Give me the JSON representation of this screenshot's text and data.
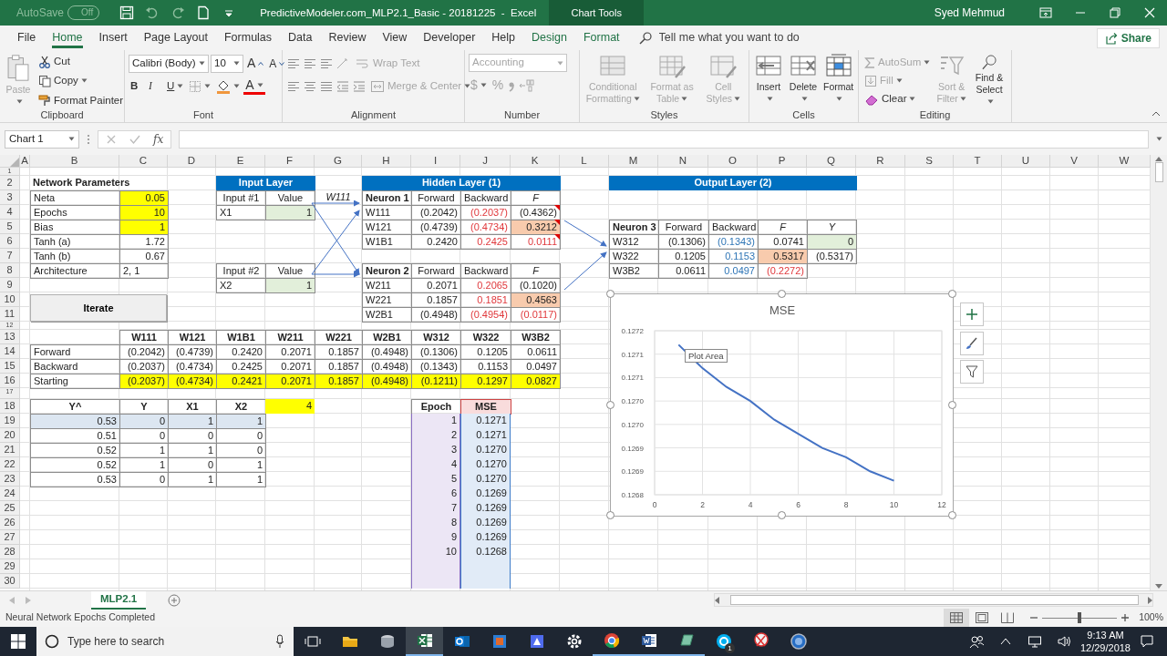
{
  "title_bar": {
    "autosave": {
      "label": "AutoSave",
      "toggle": "Off",
      "on": false
    },
    "title": "PredictiveModeler.com_MLP2.1_Basic - 20181225  -  Excel",
    "context": "Chart Tools",
    "user": "Syed Mehmud"
  },
  "tabs": [
    {
      "label": "File",
      "selected": false,
      "contextual": false
    },
    {
      "label": "Home",
      "selected": true,
      "contextual": false
    },
    {
      "label": "Insert",
      "selected": false,
      "contextual": false
    },
    {
      "label": "Page Layout",
      "selected": false,
      "contextual": false
    },
    {
      "label": "Formulas",
      "selected": false,
      "contextual": false
    },
    {
      "label": "Data",
      "selected": false,
      "contextual": false
    },
    {
      "label": "Review",
      "selected": false,
      "contextual": false
    },
    {
      "label": "View",
      "selected": false,
      "contextual": false
    },
    {
      "label": "Developer",
      "selected": false,
      "contextual": false
    },
    {
      "label": "Help",
      "selected": false,
      "contextual": false
    },
    {
      "label": "Design",
      "selected": false,
      "contextual": true
    },
    {
      "label": "Format",
      "selected": false,
      "contextual": true
    }
  ],
  "tell_me": {
    "placeholder": "Tell me what you want to do"
  },
  "share": "Share",
  "ribbon": {
    "clipboard": {
      "label": "Clipboard",
      "paste": {
        "label": "Paste",
        "disabled": true
      },
      "cut": "Cut",
      "copy": "Copy",
      "format_painter": "Format Painter"
    },
    "font": {
      "label": "Font",
      "name": "Calibri (Body)",
      "size": "10",
      "grow": "A",
      "shrink": "A",
      "bold": "B",
      "italic": "I",
      "underline": "U",
      "font_color": "A"
    },
    "alignment": {
      "label": "Alignment",
      "wrap_text": {
        "label": "Wrap Text",
        "disabled": true
      },
      "merge": {
        "label": "Merge & Center",
        "disabled": true
      }
    },
    "number": {
      "label": "Number",
      "format": {
        "value": "Accounting",
        "disabled": true
      },
      "currency": "$",
      "percent": "%"
    },
    "styles": {
      "label": "Styles",
      "items": [
        {
          "label": "Conditional Formatting",
          "disabled": true,
          "kind": "conditional"
        },
        {
          "label": "Format as Table",
          "disabled": true,
          "kind": "table"
        },
        {
          "label": "Cell Styles",
          "disabled": true,
          "kind": "styles"
        }
      ]
    },
    "cells": {
      "label": "Cells",
      "items": [
        {
          "label": "Insert",
          "disabled": false,
          "kind": "insert"
        },
        {
          "label": "Delete",
          "disabled": false,
          "kind": "delete"
        },
        {
          "label": "Format",
          "disabled": false,
          "kind": "format"
        }
      ]
    },
    "editing": {
      "label": "Editing",
      "autosum": {
        "label": "AutoSum",
        "disabled": true
      },
      "fill": {
        "label": "Fill",
        "disabled": true
      },
      "clear": {
        "label": "Clear",
        "disabled": false
      },
      "sort": {
        "label": "Sort & Filter",
        "disabled": true
      },
      "find": {
        "label": "Find & Select",
        "disabled": false
      }
    }
  },
  "formula_bar": {
    "name_box": "Chart 1",
    "function_label": "fx"
  },
  "sheet": {
    "columns": [
      "A",
      "B",
      "C",
      "D",
      "E",
      "F",
      "G",
      "H",
      "I",
      "J",
      "K",
      "L",
      "M",
      "N",
      "O",
      "P",
      "Q",
      "R",
      "S",
      "T",
      "U",
      "V",
      "W"
    ],
    "rows": [
      {
        "number": "1"
      },
      {
        "number": "2",
        "cells": {
          "B": {
            "text": "Network Parameters",
            "kind": "title"
          },
          "E": {
            "text": "Input Layer",
            "kind": "band"
          },
          "F": {
            "kind": "band"
          },
          "H": {
            "text": "Hidden Layer (1)",
            "kind": "band"
          },
          "I": {
            "kind": "band"
          },
          "J": {
            "kind": "band"
          },
          "K": {
            "kind": "band"
          },
          "M": {
            "text": "Output Layer (2)",
            "kind": "band"
          },
          "N": {
            "kind": "band"
          },
          "O": {
            "kind": "band"
          },
          "P": {
            "kind": "band"
          },
          "Q": {
            "kind": "band"
          }
        }
      },
      {
        "number": "3",
        "cells": {
          "B": {
            "text": "Neta",
            "kind": "label",
            "boxed": true
          },
          "C": {
            "text": "0.05",
            "kind": "param",
            "boxed": true
          },
          "E": {
            "text": "Input #1",
            "kind": "head",
            "boxed": true
          },
          "F": {
            "text": "Value",
            "kind": "head",
            "boxed": true
          },
          "G": {
            "text": "W111",
            "kind": "head-italic"
          },
          "H": {
            "text": "Neuron 1",
            "kind": "title",
            "boxed": true
          },
          "I": {
            "text": "Forward",
            "kind": "head",
            "boxed": true
          },
          "J": {
            "text": "Backward",
            "kind": "head",
            "boxed": true
          },
          "K": {
            "text": "F",
            "kind": "head-italic",
            "boxed": true
          }
        }
      },
      {
        "number": "4",
        "cells": {
          "B": {
            "text": "Epochs",
            "kind": "label",
            "boxed": true
          },
          "C": {
            "text": "10",
            "kind": "param",
            "boxed": true
          },
          "E": {
            "text": "X1",
            "kind": "label",
            "boxed": true
          },
          "F": {
            "text": "1",
            "kind": "given",
            "boxed": true
          },
          "H": {
            "text": "W111",
            "kind": "label",
            "boxed": true
          },
          "I": {
            "text": "(0.2042)",
            "kind": "num",
            "boxed": true
          },
          "J": {
            "text": "(0.2037)",
            "kind": "num-red",
            "boxed": true
          },
          "K": {
            "text": "(0.4362)",
            "kind": "num",
            "boxed": true,
            "comment": true
          }
        }
      },
      {
        "number": "5",
        "cells": {
          "B": {
            "text": "Bias",
            "kind": "label",
            "boxed": true
          },
          "C": {
            "text": "1",
            "kind": "param",
            "boxed": true
          },
          "H": {
            "text": "W121",
            "kind": "label",
            "boxed": true
          },
          "I": {
            "text": "(0.4739)",
            "kind": "num",
            "boxed": true
          },
          "J": {
            "text": "(0.4734)",
            "kind": "num-red",
            "boxed": true
          },
          "K": {
            "text": "0.3212",
            "kind": "peach",
            "boxed": true,
            "comment": true
          },
          "M": {
            "text": "Neuron 3",
            "kind": "title",
            "boxed": true
          },
          "N": {
            "text": "Forward",
            "kind": "head",
            "boxed": true
          },
          "O": {
            "text": "Backward",
            "kind": "head",
            "boxed": true
          },
          "P": {
            "text": "F",
            "kind": "head-italic",
            "boxed": true
          },
          "Q": {
            "text": "Y",
            "kind": "head-italic",
            "boxed": true
          }
        }
      },
      {
        "number": "6",
        "cells": {
          "B": {
            "text": "Tanh (a)",
            "kind": "label",
            "boxed": true
          },
          "C": {
            "text": "1.72",
            "kind": "num",
            "boxed": true
          },
          "H": {
            "text": "W1B1",
            "kind": "label",
            "boxed": true
          },
          "I": {
            "text": "0.2420",
            "kind": "num",
            "boxed": true
          },
          "J": {
            "text": "0.2425",
            "kind": "num-red",
            "boxed": true
          },
          "K": {
            "text": "0.0111",
            "kind": "num-red",
            "boxed": true,
            "comment": true
          },
          "M": {
            "text": "W312",
            "kind": "label",
            "boxed": true
          },
          "N": {
            "text": "(0.1306)",
            "kind": "num",
            "boxed": true
          },
          "O": {
            "text": "(0.1343)",
            "kind": "num-blue",
            "boxed": true
          },
          "P": {
            "text": "0.0741",
            "kind": "num",
            "boxed": true
          },
          "Q": {
            "text": "0",
            "kind": "given",
            "boxed": true
          }
        }
      },
      {
        "number": "7",
        "cells": {
          "B": {
            "text": "Tanh (b)",
            "kind": "label",
            "boxed": true
          },
          "C": {
            "text": "0.67",
            "kind": "num",
            "boxed": true
          },
          "M": {
            "text": "W322",
            "kind": "label",
            "boxed": true
          },
          "N": {
            "text": "0.1205",
            "kind": "num",
            "boxed": true
          },
          "O": {
            "text": "0.1153",
            "kind": "num-blue",
            "boxed": true
          },
          "P": {
            "text": "0.5317",
            "kind": "peach",
            "boxed": true
          },
          "Q": {
            "text": "(0.5317)",
            "kind": "num",
            "boxed": true
          }
        }
      },
      {
        "number": "8",
        "cells": {
          "B": {
            "text": "Architecture",
            "kind": "label",
            "boxed": true
          },
          "C": {
            "text": "2, 1",
            "kind": "label",
            "boxed": true
          },
          "E": {
            "text": "Input #2",
            "kind": "head",
            "boxed": true
          },
          "F": {
            "text": "Value",
            "kind": "head",
            "boxed": true
          },
          "H": {
            "text": "Neuron 2",
            "kind": "title",
            "boxed": true
          },
          "I": {
            "text": "Forward",
            "kind": "head",
            "boxed": true
          },
          "J": {
            "text": "Backward",
            "kind": "head",
            "boxed": true
          },
          "K": {
            "text": "F",
            "kind": "head-italic",
            "boxed": true
          },
          "M": {
            "text": "W3B2",
            "kind": "label",
            "boxed": true
          },
          "N": {
            "text": "0.0611",
            "kind": "num",
            "boxed": true
          },
          "O": {
            "text": "0.0497",
            "kind": "num-blue",
            "boxed": true
          },
          "P": {
            "text": "(0.2272)",
            "kind": "num-red",
            "boxed": true
          }
        }
      },
      {
        "number": "9",
        "cells": {
          "E": {
            "text": "X2",
            "kind": "label",
            "boxed": true
          },
          "F": {
            "text": "1",
            "kind": "given",
            "boxed": true
          },
          "H": {
            "text": "W211",
            "kind": "label",
            "boxed": true
          },
          "I": {
            "text": "0.2071",
            "kind": "num",
            "boxed": true
          },
          "J": {
            "text": "0.2065",
            "kind": "num-red",
            "boxed": true
          },
          "K": {
            "text": "(0.1020)",
            "kind": "num",
            "boxed": true
          }
        }
      },
      {
        "number": "10",
        "cells": {
          "H": {
            "text": "W221",
            "kind": "label",
            "boxed": true
          },
          "I": {
            "text": "0.1857",
            "kind": "num",
            "boxed": true
          },
          "J": {
            "text": "0.1851",
            "kind": "num-red",
            "boxed": true
          },
          "K": {
            "text": "0.4563",
            "kind": "peach",
            "boxed": true
          }
        }
      },
      {
        "number": "11",
        "cells": {
          "H": {
            "text": "W2B1",
            "kind": "label",
            "boxed": true
          },
          "I": {
            "text": "(0.4948)",
            "kind": "num",
            "boxed": true
          },
          "J": {
            "text": "(0.4954)",
            "kind": "num-red",
            "boxed": true
          },
          "K": {
            "text": "(0.0117)",
            "kind": "num-red",
            "boxed": true
          }
        }
      },
      {
        "number": "12"
      },
      {
        "number": "13",
        "cells": {
          "C": {
            "text": "W111",
            "kind": "head-bold",
            "boxed": true
          },
          "D": {
            "text": "W121",
            "kind": "head-bold",
            "boxed": true
          },
          "E": {
            "text": "W1B1",
            "kind": "head-bold",
            "boxed": true
          },
          "F": {
            "text": "W211",
            "kind": "head-bold",
            "boxed": true
          },
          "G": {
            "text": "W221",
            "kind": "head-bold",
            "boxed": true
          },
          "H": {
            "text": "W2B1",
            "kind": "head-bold",
            "boxed": true
          },
          "I": {
            "text": "W312",
            "kind": "head-bold",
            "boxed": true
          },
          "J": {
            "text": "W322",
            "kind": "head-bold",
            "boxed": true
          },
          "K": {
            "text": "W3B2",
            "kind": "head-bold",
            "boxed": true
          }
        }
      },
      {
        "number": "14",
        "cells": {
          "B": {
            "text": "Forward",
            "kind": "label",
            "boxed": true
          },
          "C": {
            "text": "(0.2042)",
            "kind": "num",
            "boxed": true
          },
          "D": {
            "text": "(0.4739)",
            "kind": "num",
            "boxed": true
          },
          "E": {
            "text": "0.2420",
            "kind": "num",
            "boxed": true
          },
          "F": {
            "text": "0.2071",
            "kind": "num",
            "boxed": true
          },
          "G": {
            "text": "0.1857",
            "kind": "num",
            "boxed": true
          },
          "H": {
            "text": "(0.4948)",
            "kind": "num",
            "boxed": true
          },
          "I": {
            "text": "(0.1306)",
            "kind": "num",
            "boxed": true
          },
          "J": {
            "text": "0.1205",
            "kind": "num",
            "boxed": true
          },
          "K": {
            "text": "0.0611",
            "kind": "num",
            "boxed": true
          }
        }
      },
      {
        "number": "15",
        "cells": {
          "B": {
            "text": "Backward",
            "kind": "label",
            "boxed": true
          },
          "C": {
            "text": "(0.2037)",
            "kind": "num",
            "boxed": true
          },
          "D": {
            "text": "(0.4734)",
            "kind": "num",
            "boxed": true
          },
          "E": {
            "text": "0.2425",
            "kind": "num",
            "boxed": true
          },
          "F": {
            "text": "0.2071",
            "kind": "num",
            "boxed": true
          },
          "G": {
            "text": "0.1857",
            "kind": "num",
            "boxed": true
          },
          "H": {
            "text": "(0.4948)",
            "kind": "num",
            "boxed": true
          },
          "I": {
            "text": "(0.1343)",
            "kind": "num",
            "boxed": true
          },
          "J": {
            "text": "0.1153",
            "kind": "num",
            "boxed": true
          },
          "K": {
            "text": "0.0497",
            "kind": "num",
            "boxed": true
          }
        }
      },
      {
        "number": "16",
        "cells": {
          "B": {
            "text": "Starting",
            "kind": "label",
            "boxed": true
          },
          "C": {
            "text": "(0.2037)",
            "kind": "param",
            "boxed": true
          },
          "D": {
            "text": "(0.4734)",
            "kind": "param",
            "boxed": true
          },
          "E": {
            "text": "0.2421",
            "kind": "param",
            "boxed": true
          },
          "F": {
            "text": "0.2071",
            "kind": "param",
            "boxed": true
          },
          "G": {
            "text": "0.1857",
            "kind": "param",
            "boxed": true
          },
          "H": {
            "text": "(0.4948)",
            "kind": "param",
            "boxed": true
          },
          "I": {
            "text": "(0.1211)",
            "kind": "param",
            "boxed": true
          },
          "J": {
            "text": "0.1297",
            "kind": "param",
            "boxed": true
          },
          "K": {
            "text": "0.0827",
            "kind": "param",
            "boxed": true
          }
        }
      },
      {
        "number": "17"
      },
      {
        "number": "18",
        "cells": {
          "B": {
            "text": "Y^",
            "kind": "head-bold",
            "boxed": true
          },
          "C": {
            "text": "Y",
            "kind": "head-bold",
            "boxed": true
          },
          "D": {
            "text": "X1",
            "kind": "head-bold",
            "boxed": true
          },
          "E": {
            "text": "X2",
            "kind": "head-bold",
            "boxed": true
          },
          "F": {
            "text": "4",
            "kind": "param"
          },
          "I": {
            "text": "Epoch",
            "kind": "head-bold",
            "boxed": true
          },
          "J": {
            "text": "MSE",
            "kind": "series-name",
            "boxed": true
          }
        }
      },
      {
        "number": "19",
        "cells": {
          "B": {
            "text": "0.53",
            "kind": "shade",
            "boxed": true
          },
          "C": {
            "text": "0",
            "kind": "shade",
            "boxed": true
          },
          "D": {
            "text": "1",
            "kind": "shade",
            "boxed": true
          },
          "E": {
            "text": "1",
            "kind": "shade",
            "boxed": true
          },
          "I": {
            "text": "1",
            "kind": "series-x"
          },
          "J": {
            "text": "0.1271",
            "kind": "series-y"
          }
        }
      },
      {
        "number": "20",
        "cells": {
          "B": {
            "text": "0.51",
            "kind": "num",
            "boxed": true
          },
          "C": {
            "text": "0",
            "kind": "num",
            "boxed": true
          },
          "D": {
            "text": "0",
            "kind": "num",
            "boxed": true
          },
          "E": {
            "text": "0",
            "kind": "num",
            "boxed": true
          },
          "I": {
            "text": "2",
            "kind": "series-x"
          },
          "J": {
            "text": "0.1271",
            "kind": "series-y"
          }
        }
      },
      {
        "number": "21",
        "cells": {
          "B": {
            "text": "0.52",
            "kind": "num",
            "boxed": true
          },
          "C": {
            "text": "1",
            "kind": "num",
            "boxed": true
          },
          "D": {
            "text": "1",
            "kind": "num",
            "boxed": true
          },
          "E": {
            "text": "0",
            "kind": "num",
            "boxed": true
          },
          "I": {
            "text": "3",
            "kind": "series-x"
          },
          "J": {
            "text": "0.1270",
            "kind": "series-y"
          }
        }
      },
      {
        "number": "22",
        "cells": {
          "B": {
            "text": "0.52",
            "kind": "num",
            "boxed": true
          },
          "C": {
            "text": "1",
            "kind": "num",
            "boxed": true
          },
          "D": {
            "text": "0",
            "kind": "num",
            "boxed": true
          },
          "E": {
            "text": "1",
            "kind": "num",
            "boxed": true
          },
          "I": {
            "text": "4",
            "kind": "series-x"
          },
          "J": {
            "text": "0.1270",
            "kind": "series-y"
          }
        }
      },
      {
        "number": "23",
        "cells": {
          "B": {
            "text": "0.53",
            "kind": "num",
            "boxed": true
          },
          "C": {
            "text": "0",
            "kind": "num",
            "boxed": true
          },
          "D": {
            "text": "1",
            "kind": "num",
            "boxed": true
          },
          "E": {
            "text": "1",
            "kind": "num",
            "boxed": true
          },
          "I": {
            "text": "5",
            "kind": "series-x"
          },
          "J": {
            "text": "0.1270",
            "kind": "series-y"
          }
        }
      },
      {
        "number": "24",
        "cells": {
          "I": {
            "text": "6",
            "kind": "series-x"
          },
          "J": {
            "text": "0.1269",
            "kind": "series-y"
          }
        }
      },
      {
        "number": "25",
        "cells": {
          "I": {
            "text": "7",
            "kind": "series-x"
          },
          "J": {
            "text": "0.1269",
            "kind": "series-y"
          }
        }
      },
      {
        "number": "26",
        "cells": {
          "I": {
            "text": "8",
            "kind": "series-x"
          },
          "J": {
            "text": "0.1269",
            "kind": "series-y"
          }
        }
      },
      {
        "number": "27",
        "cells": {
          "I": {
            "text": "9",
            "kind": "series-x"
          },
          "J": {
            "text": "0.1269",
            "kind": "series-y"
          }
        }
      },
      {
        "number": "28",
        "cells": {
          "I": {
            "text": "10",
            "kind": "series-x"
          },
          "J": {
            "text": "0.1268",
            "kind": "series-y"
          }
        }
      },
      {
        "number": "29",
        "cells": {
          "I": {
            "kind": "series-x"
          },
          "J": {
            "kind": "series-y"
          }
        }
      },
      {
        "number": "30",
        "cells": {
          "I": {
            "kind": "series-x"
          },
          "J": {
            "kind": "series-y"
          }
        }
      }
    ]
  },
  "iterate_button": {
    "label": "Iterate"
  },
  "chart": {
    "selected": true,
    "tooltip": "Plot Area",
    "chart_data": {
      "type": "line",
      "title": "MSE",
      "grid": true,
      "x": [
        1,
        2,
        3,
        4,
        5,
        6,
        7,
        8,
        9,
        10
      ],
      "series": [
        {
          "color": "#4472c4",
          "values": [
            0.12717,
            0.12712,
            0.12708,
            0.12705,
            0.12701,
            0.12698,
            0.12695,
            0.12693,
            0.1269,
            0.12688
          ]
        }
      ],
      "xlim": [
        0,
        12
      ],
      "ylim": [
        0.12685,
        0.1272
      ],
      "xticks": [
        0,
        2,
        4,
        6,
        8,
        10,
        12
      ],
      "yticks": [
        {
          "value": 0.1272,
          "label": "0.1272"
        },
        {
          "value": 0.12715,
          "label": "0.1271"
        },
        {
          "value": 0.1271,
          "label": "0.1271"
        },
        {
          "value": 0.12705,
          "label": "0.1270"
        },
        {
          "value": 0.127,
          "label": "0.1270"
        },
        {
          "value": 0.12695,
          "label": "0.1269"
        },
        {
          "value": 0.1269,
          "label": "0.1269"
        },
        {
          "value": 0.12685,
          "label": "0.1268"
        }
      ]
    }
  },
  "sheet_tabs": [
    {
      "label": "MLP2.1",
      "selected": true
    }
  ],
  "status_bar": {
    "message": "Neural Network Epochs Completed",
    "views": [
      {
        "kind": "normal",
        "selected": true
      },
      {
        "kind": "layout",
        "selected": false
      },
      {
        "kind": "break",
        "selected": false
      }
    ],
    "zoom_slider": {
      "level": 0.5
    },
    "zoom": "100%"
  },
  "taskbar": {
    "search": {
      "placeholder": "Type here to search"
    },
    "apps": [
      {
        "kind": "folder",
        "running": false,
        "active": false
      },
      {
        "kind": "disk",
        "running": false,
        "active": false
      },
      {
        "kind": "sheet",
        "running": true,
        "active": true
      },
      {
        "kind": "mail",
        "running": false,
        "active": false
      },
      {
        "kind": "tile",
        "running": false,
        "active": false
      },
      {
        "kind": "tile2",
        "running": false,
        "active": false
      },
      {
        "kind": "gear",
        "running": false,
        "active": false
      },
      {
        "kind": "browser",
        "running": true,
        "active": false
      },
      {
        "kind": "doc",
        "running": true,
        "active": false
      },
      {
        "kind": "note",
        "running": true,
        "active": false
      },
      {
        "kind": "chat",
        "running": false,
        "active": false,
        "badge": "1"
      },
      {
        "kind": "snip",
        "running": false,
        "active": false
      },
      {
        "kind": "globe",
        "running": false,
        "active": false
      }
    ],
    "time": "9:13 AM",
    "date": "12/29/2018"
  }
}
